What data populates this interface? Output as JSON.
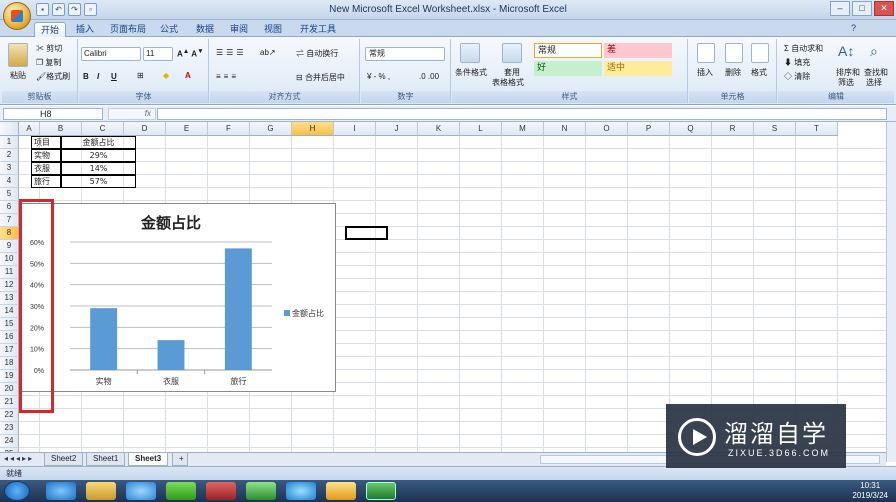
{
  "window": {
    "title": "New Microsoft Excel Worksheet.xlsx - Microsoft Excel"
  },
  "tabs": [
    "开始",
    "插入",
    "页面布局",
    "公式",
    "数据",
    "审阅",
    "视图",
    "开发工具"
  ],
  "ribbon": {
    "clipboard": {
      "paste": "粘贴",
      "cut": "剪切",
      "copy": "复制",
      "format_painter": "格式刷",
      "label": "剪贴板"
    },
    "font": {
      "name": "Calibri",
      "size": "11",
      "label": "字体"
    },
    "alignment": {
      "wrap": "自动换行",
      "merge": "合并后居中",
      "label": "对齐方式"
    },
    "number": {
      "format": "常规",
      "label": "数字"
    },
    "styles": {
      "conditional": "条件格式",
      "table": "套用",
      "table2": "表格格式",
      "normal": "常规",
      "bad": "差",
      "good": "好",
      "neutral": "适中",
      "label": "样式"
    },
    "cells": {
      "insert": "插入",
      "delete": "删除",
      "format": "格式",
      "label": "单元格"
    },
    "editing": {
      "autosum": "自动求和",
      "fill": "填充",
      "clear": "清除",
      "sort": "排序和",
      "sort2": "筛选",
      "find": "查找和",
      "find2": "选择",
      "label": "编辑"
    }
  },
  "formula_bar": {
    "name_box": "H8",
    "fx": "fx"
  },
  "columns": [
    "A",
    "B",
    "C",
    "D",
    "E",
    "F",
    "G",
    "H",
    "I",
    "J",
    "K",
    "L",
    "M",
    "N",
    "O",
    "P",
    "Q",
    "R",
    "S",
    "T"
  ],
  "rows": [
    "1",
    "2",
    "3",
    "4",
    "5",
    "6",
    "7",
    "8",
    "9",
    "10",
    "11",
    "12",
    "13",
    "14",
    "15",
    "16",
    "17",
    "18",
    "19",
    "20",
    "21",
    "22",
    "23",
    "24",
    "25"
  ],
  "table": {
    "header": [
      "项目",
      "金额占比"
    ],
    "rows": [
      [
        "实物",
        "29%"
      ],
      [
        "衣服",
        "14%"
      ],
      [
        "旅行",
        "57%"
      ]
    ]
  },
  "chart_data": {
    "type": "bar",
    "title": "金额占比",
    "categories": [
      "实物",
      "衣服",
      "旅行"
    ],
    "series": [
      {
        "name": "金额占比",
        "values": [
          0.29,
          0.14,
          0.57
        ],
        "color": "#5b9bd5"
      }
    ],
    "ylim": [
      0,
      0.6
    ],
    "yticks": [
      "0%",
      "10%",
      "20%",
      "30%",
      "40%",
      "50%",
      "60%"
    ],
    "grid": true,
    "legend": "right"
  },
  "sheets": [
    "Sheet2",
    "Sheet1",
    "Sheet3"
  ],
  "active_sheet": "Sheet3",
  "status": {
    "text": "就绪"
  },
  "taskbar": {
    "time": "10:31",
    "date": "2019/3/24"
  },
  "watermark": {
    "title": "溜溜自学",
    "url": "ZIXUE.3D66.COM"
  }
}
